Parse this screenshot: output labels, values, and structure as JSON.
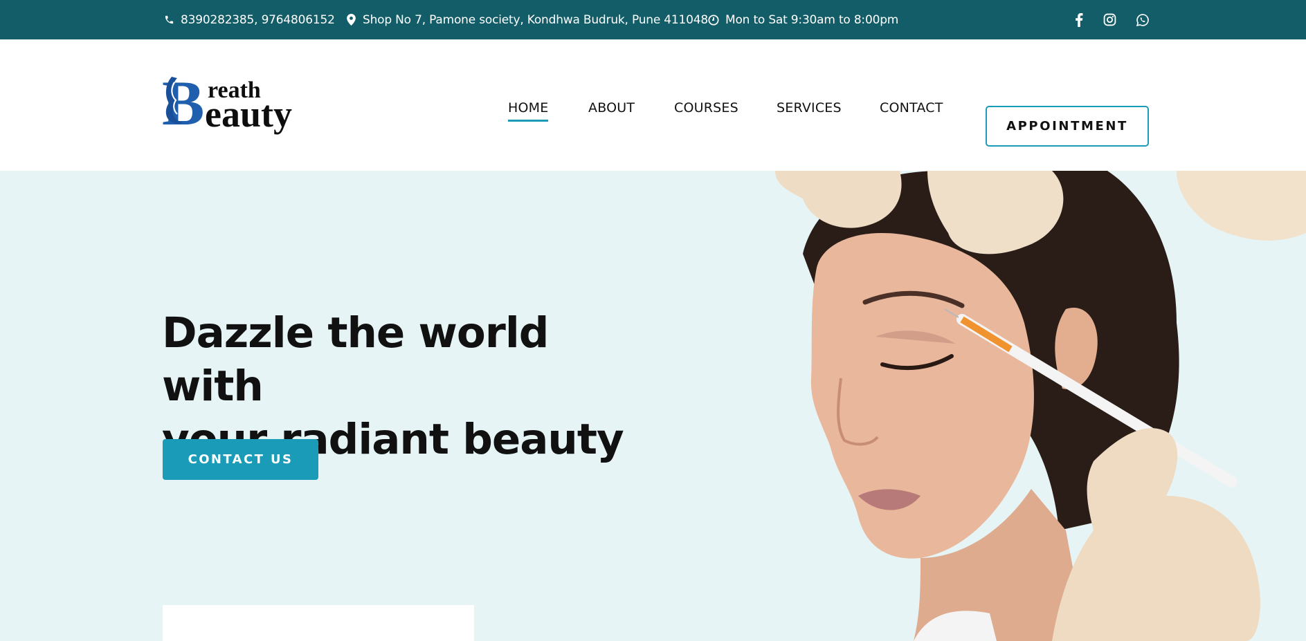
{
  "topbar": {
    "phone": "8390282385, 9764806152",
    "address": "Shop No 7, Pamone society, Kondhwa Budruk, Pune 411048",
    "hours": "Mon to Sat 9:30am to 8:00pm",
    "social": [
      "facebook-icon",
      "instagram-icon",
      "whatsapp-icon"
    ]
  },
  "header": {
    "logo_top": "reath",
    "logo_bottom": "eauty",
    "logo_initial": "B",
    "nav": [
      "HOME",
      "ABOUT",
      "COURSES",
      "SERVICES",
      "CONTACT"
    ],
    "active_nav": "HOME",
    "appointment_label": "APPOINTMENT"
  },
  "hero": {
    "title_line1": "Dazzle the world with",
    "title_line2": "your radiant beauty",
    "cta_label": "CONTACT US"
  },
  "colors": {
    "topbar_bg": "#125d67",
    "accent": "#1a9bb7",
    "hero_bg": "#e7f4f5",
    "logo_blue": "#1f5fae"
  }
}
